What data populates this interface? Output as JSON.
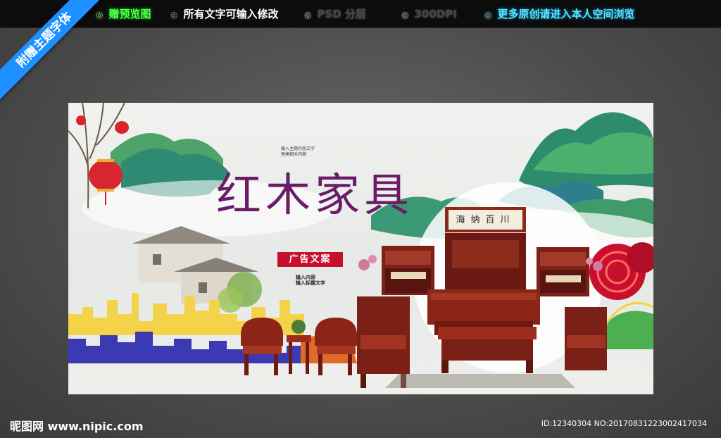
{
  "ribbon": {
    "label": "附赠主题字体"
  },
  "topbar": {
    "items": [
      {
        "label": "赠预览图"
      },
      {
        "label": "所有文字可输入修改"
      },
      {
        "label": "PSD 分层"
      },
      {
        "label": "300DPI"
      },
      {
        "label": "更多原创请进入本人空间浏览"
      }
    ],
    "bullet": "◎"
  },
  "poster": {
    "title": "红木家具",
    "stamp": "广告文案",
    "small_text": [
      "输入主题内容文字",
      "替换相关内容"
    ],
    "caption": [
      "输入内容",
      "输入标题文字"
    ],
    "plaque": "海纳百川"
  },
  "footer": {
    "logo": "昵图网 www.nipic.com",
    "id": "ID:12340304 NO:20170831223002417034"
  }
}
